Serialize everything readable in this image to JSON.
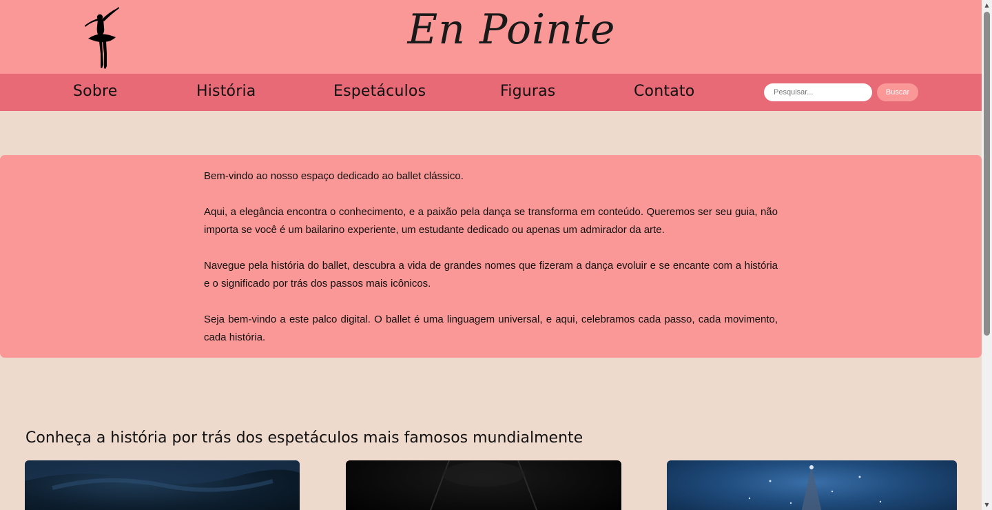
{
  "header": {
    "brand": "En Pointe"
  },
  "nav": {
    "links": [
      "Sobre",
      "História",
      "Espetáculos",
      "Figuras",
      "Contato"
    ],
    "search_placeholder": "Pesquisar...",
    "search_button": "Buscar"
  },
  "intro": {
    "paragraphs": [
      "Bem-vindo ao nosso espaço dedicado ao ballet clássico.",
      "Aqui, a elegância encontra o conhecimento, e a paixão pela dança se transforma em conteúdo. Queremos ser seu guia, não importa se você é um bailarino experiente, um estudante dedicado ou apenas um admirador da arte.",
      "Navegue pela história do ballet, descubra a vida de grandes nomes que fizeram a dança evoluir e se encante com a história e o significado por trás dos passos mais icônicos.",
      "Seja bem-vindo a este palco digital. O ballet é uma linguagem universal, e aqui, celebramos cada passo, cada movimento, cada história."
    ]
  },
  "shows": {
    "title": "Conheça a história por trás dos espetáculos mais famosos mundialmente"
  },
  "colors": {
    "header_bg": "#fa9797",
    "nav_bg": "#e86a76",
    "page_bg": "#eed9cd",
    "card_bg": "#fa9797"
  },
  "icons": {
    "logo": "ballerina-silhouette-icon"
  }
}
